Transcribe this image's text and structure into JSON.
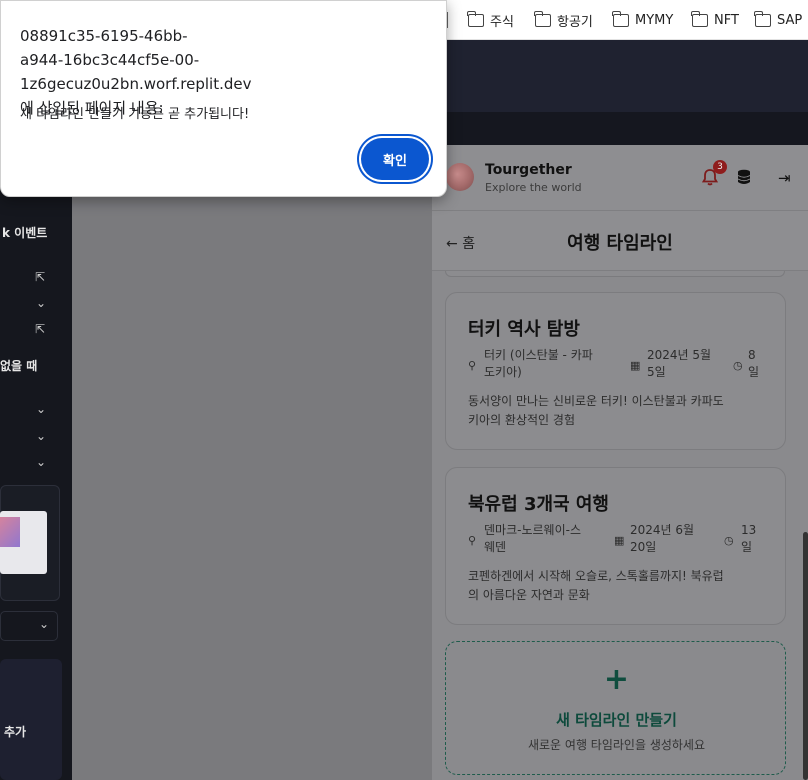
{
  "bookmarks": [
    {
      "label": "주식",
      "icon": "folder-icon"
    },
    {
      "label": "항공기",
      "icon": "folder-icon"
    },
    {
      "label": "MYMY",
      "icon": "folder-icon"
    },
    {
      "label": "NFT",
      "icon": "folder-icon"
    },
    {
      "label": "SAP",
      "icon": "folder-icon"
    }
  ],
  "sidebar": {
    "event_label": "k 이벤트",
    "empty_label": "없을 때",
    "add_label": "추가"
  },
  "app": {
    "brand": "Tourgether",
    "tagline": "Explore the world",
    "notification_count": "3",
    "back_label": "홈",
    "page_title": "여행 타임라인"
  },
  "timelines": [
    {
      "title": "터키 역사 탐방",
      "location": "터키 (이스탄불 - 카파도키아)",
      "location_lines": [
        "터키 (이스탄불 - 카파",
        "도키아)"
      ],
      "date_lines": [
        "2024년 5월",
        "5일"
      ],
      "duration_lines": [
        "8",
        "일"
      ],
      "description": "동서양이 만나는 신비로운 터키! 이스탄불과 카파도키아의 환상적인 경험",
      "description_lines": [
        "동서양이 만나는 신비로운 터키! 이스탄불과 카파도",
        "키아의 환상적인 경험"
      ]
    },
    {
      "title": "북유럽 3개국 여행",
      "location": "덴마크-노르웨이-스웨덴",
      "location_lines": [
        "덴마크-노르웨이-스",
        "웨덴"
      ],
      "date_lines": [
        "2024년 6월",
        "20일"
      ],
      "duration_lines": [
        "13",
        "일"
      ],
      "description": "코펜하겐에서 시작해 오슬로, 스톡홀름까지! 북유럽의 아름다운 자연과 문화",
      "description_lines": [
        "코펜하겐에서 시작해 오슬로, 스톡홀름까지! 북유럽",
        "의 아름다운 자연과 문화"
      ]
    }
  ],
  "new_timeline": {
    "plus": "+",
    "title": "새 타임라인 만들기",
    "subtitle": "새로운 여행 타임라인을 생성하세요"
  },
  "dialog": {
    "title": "08891c35-6195-46bb-a944-16bc3c44cf5e-00-1z6gecuz0u2bn.worf.replit.dev 에 삽입된 페이지 내용:",
    "title_lines": [
      "08891c35-6195-46bb-",
      "a944-16bc3c44cf5e-00-1z6gecuz0u2bn.worf.replit.dev",
      "에 삽입된 페이지 내용:"
    ],
    "message": "새 타임라인 만들기 기능은 곧 추가됩니다!",
    "ok_label": "확인"
  },
  "colors": {
    "dialog_button": "#0b57d0",
    "badge": "#8f1d1d",
    "accent_green": "#0d4a3c"
  }
}
